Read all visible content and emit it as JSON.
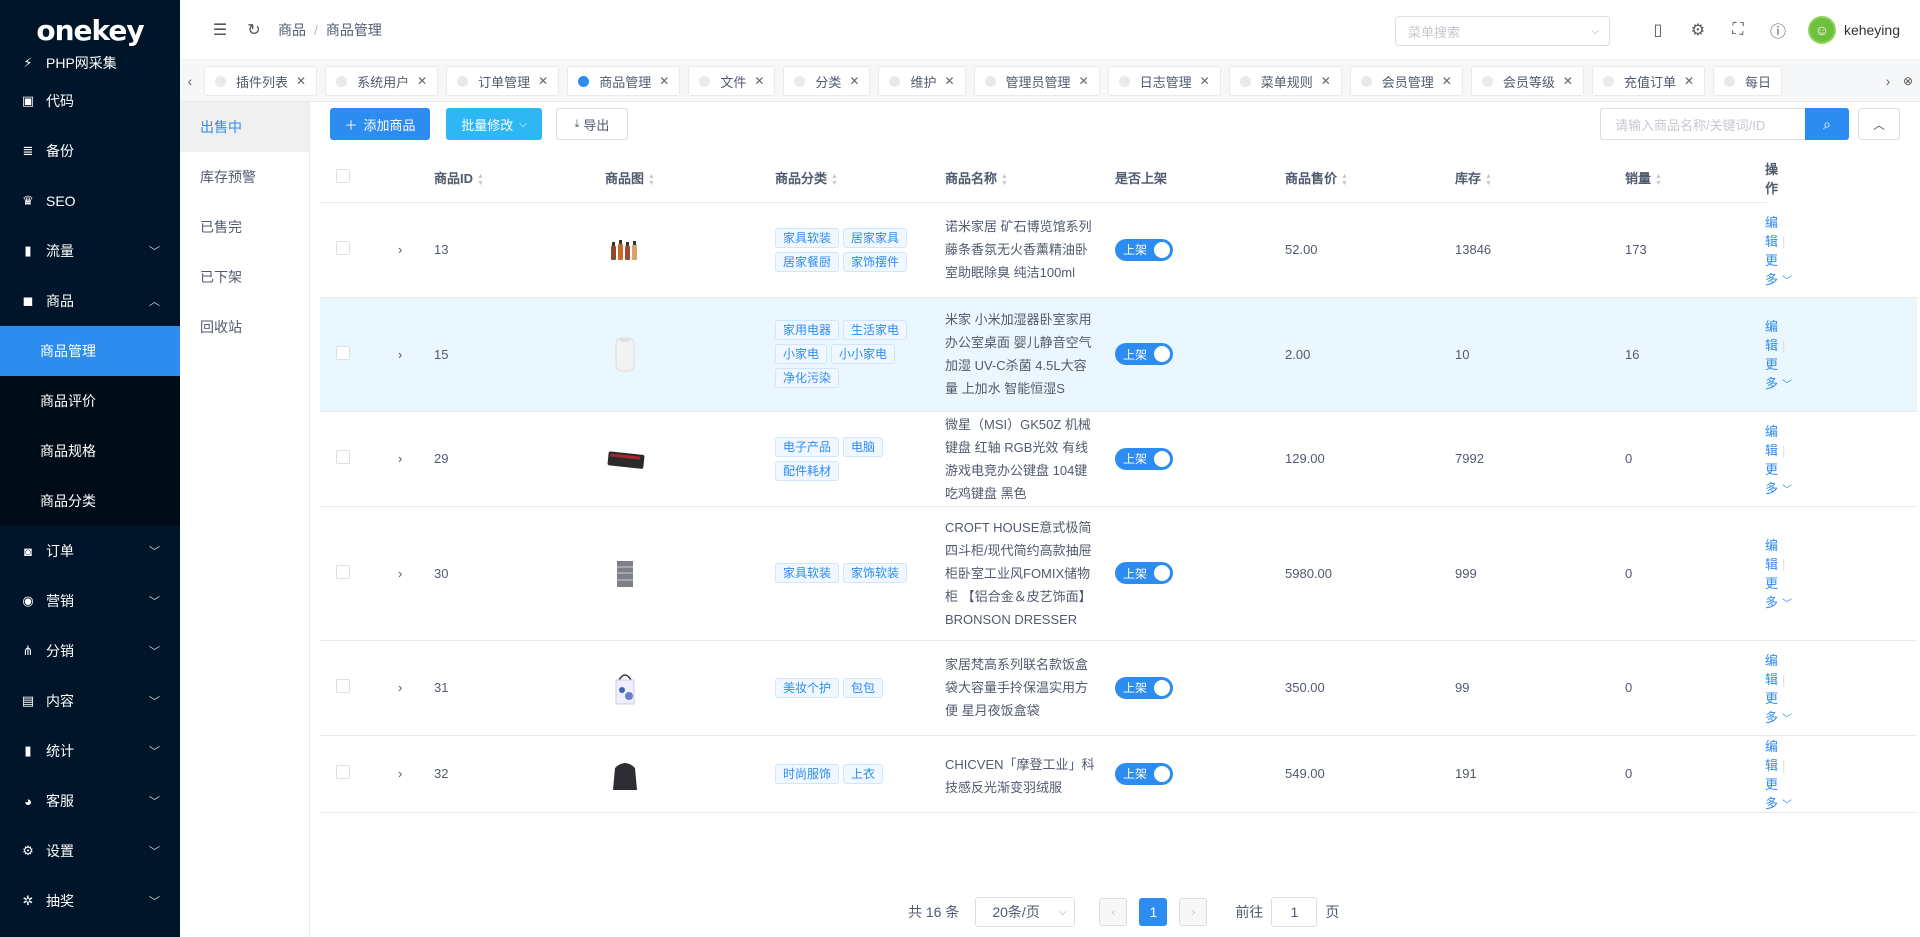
{
  "app": {
    "logo": "onekey"
  },
  "sidebar": {
    "partial_item": "PHP网采集",
    "items": [
      {
        "label": "代码",
        "icon": "code-icon",
        "glyph": "▣"
      },
      {
        "label": "备份",
        "icon": "database-icon",
        "glyph": "≣"
      },
      {
        "label": "SEO",
        "icon": "trophy-icon",
        "glyph": "♛"
      },
      {
        "label": "流量",
        "icon": "bar-chart-icon",
        "glyph": "▮"
      },
      {
        "label": "商品",
        "icon": "shopping-bag-icon",
        "glyph": "◼"
      }
    ],
    "sub_items": [
      {
        "label": "商品管理",
        "active": true
      },
      {
        "label": "商品评价"
      },
      {
        "label": "商品规格"
      },
      {
        "label": "商品分类"
      }
    ],
    "items_after": [
      {
        "label": "订单",
        "icon": "order-icon",
        "glyph": "◙"
      },
      {
        "label": "营销",
        "icon": "marketing-icon",
        "glyph": "◉"
      },
      {
        "label": "分销",
        "icon": "distribution-icon",
        "glyph": "⋔"
      },
      {
        "label": "内容",
        "icon": "content-icon",
        "glyph": "▤"
      },
      {
        "label": "统计",
        "icon": "statistics-icon",
        "glyph": "▮"
      },
      {
        "label": "客服",
        "icon": "customer-service-icon",
        "glyph": "◕"
      },
      {
        "label": "设置",
        "icon": "settings-icon",
        "glyph": "⚙"
      },
      {
        "label": "抽奖",
        "icon": "lottery-icon",
        "glyph": "✲"
      }
    ]
  },
  "header": {
    "breadcrumb": [
      "商品",
      "商品管理"
    ],
    "menu_search_placeholder": "菜单搜索",
    "username": "keheying"
  },
  "tabs": [
    "插件列表",
    "系统用户",
    "订单管理",
    "商品管理",
    "文件",
    "分类",
    "维护",
    "管理员管理",
    "日志管理",
    "菜单规则",
    "会员管理",
    "会员等级",
    "充值订单",
    "每日"
  ],
  "active_tab": "商品管理",
  "status_nav": [
    "出售中",
    "库存预警",
    "已售完",
    "已下架",
    "回收站"
  ],
  "toolbar": {
    "add_label": "添加商品",
    "batch_label": "批量修改",
    "export_label": "导出",
    "search_placeholder": "请输入商品名称/关键词/ID"
  },
  "table": {
    "headers": {
      "id": "商品ID",
      "image": "商品图",
      "category": "商品分类",
      "name": "商品名称",
      "on_sale": "是否上架",
      "price": "商品售价",
      "stock": "库存",
      "sales": "销量",
      "ops": "操作"
    },
    "switch_label": "上架",
    "edit_label": "编辑",
    "more_label": "更多",
    "rows": [
      {
        "id": "13",
        "image": "perfume-bottles",
        "tags": [
          "家具软装",
          "居家家具",
          "居家餐厨",
          "家饰摆件"
        ],
        "name": "诺米家居 矿石博览馆系列藤条香氛无火香薰精油卧室助眠除臭 纯洁100ml",
        "price": "52.00",
        "stock": "13846",
        "sales": "173"
      },
      {
        "id": "15",
        "image": "humidifier",
        "tags": [
          "家用电器",
          "生活家电",
          "小家电",
          "小小家电",
          "净化污染"
        ],
        "name": "米家 小米加湿器卧室家用办公室桌面 婴儿静音空气加湿 UV-C杀菌 4.5L大容量 上加水 智能恒湿S",
        "price": "2.00",
        "stock": "10",
        "sales": "16",
        "highlight": true
      },
      {
        "id": "29",
        "image": "keyboard",
        "tags": [
          "电子产品",
          "电脑",
          "配件耗材"
        ],
        "name": "微星（MSI）GK50Z 机械键盘 红轴 RGB光效 有线 游戏电竞办公键盘 104键 吃鸡键盘 黑色",
        "price": "129.00",
        "stock": "7992",
        "sales": "0"
      },
      {
        "id": "30",
        "image": "cabinet",
        "tags": [
          "家具软装",
          "家饰软装"
        ],
        "name": "CROFT HOUSE意式极简四斗柜/现代简约高款抽屉柜卧室工业风FOMIX储物柜 【铝合金＆皮艺饰面】 BRONSON DRESSER",
        "price": "5980.00",
        "stock": "999",
        "sales": "0"
      },
      {
        "id": "31",
        "image": "tote-bag",
        "tags": [
          "美妆个护",
          "包包"
        ],
        "name": "家居梵高系列联名款饭盒袋大容量手拎保温实用方便 星月夜饭盒袋",
        "price": "350.00",
        "stock": "99",
        "sales": "0"
      },
      {
        "id": "32",
        "image": "jacket",
        "tags": [
          "时尚服饰",
          "上衣"
        ],
        "name": "CHICVEN「摩登工业」科技感反光渐变羽绒服",
        "price": "549.00",
        "stock": "191",
        "sales": "0"
      }
    ]
  },
  "pagination": {
    "total": "共 16 条",
    "page_size": "20条/页",
    "current": "1",
    "goto_label": "前往",
    "goto_value": "1",
    "page_suffix": "页"
  }
}
